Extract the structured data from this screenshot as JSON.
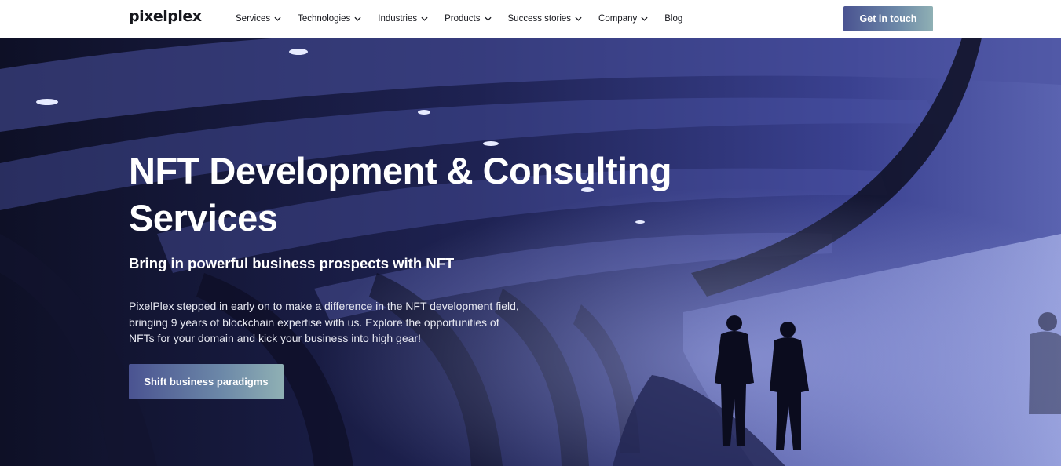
{
  "header": {
    "logo": "pixelplex",
    "nav": [
      {
        "label": "Services",
        "has_dropdown": true
      },
      {
        "label": "Technologies",
        "has_dropdown": true
      },
      {
        "label": "Industries",
        "has_dropdown": true
      },
      {
        "label": "Products",
        "has_dropdown": true
      },
      {
        "label": "Success stories",
        "has_dropdown": true
      },
      {
        "label": "Company",
        "has_dropdown": true
      },
      {
        "label": "Blog",
        "has_dropdown": false
      }
    ],
    "cta_label": "Get in touch"
  },
  "hero": {
    "title_line1": "NFT Development & Consulting",
    "title_line2": "Services",
    "subtitle": "Bring in powerful business prospects with NFT",
    "description": "PixelPlex stepped in early on to make a difference in the NFT development field, bringing 9 years of blockchain expertise with us. Explore the opportunities of NFTs for your domain and kick your business into high gear!",
    "cta_label": "Shift business paradigms"
  },
  "colors": {
    "accent_start": "#4a5391",
    "accent_end": "#8fb0b4",
    "hero_tint": "#2a2f6b",
    "text_dark": "#16171d"
  },
  "icons": {
    "dropdown": "chevron-down-icon"
  }
}
